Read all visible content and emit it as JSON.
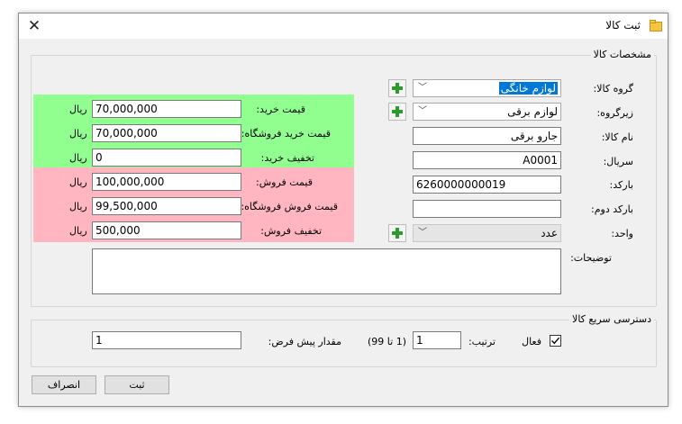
{
  "window": {
    "title": "ثبت کالا"
  },
  "product_details": {
    "legend": "مشخصات کالا",
    "group": {
      "label": "گروه کالا:",
      "value": "لوازم خانگی"
    },
    "subgroup": {
      "label": "زیرگروه:",
      "value": "لوازم برقی"
    },
    "name": {
      "label": "نام کالا:",
      "value": "جارو برقی"
    },
    "serial": {
      "label": "سریال:",
      "value": "A0001"
    },
    "barcode": {
      "label": "بارکد:",
      "value": "6260000000019"
    },
    "barcode2": {
      "label": "بارکد دوم:",
      "value": ""
    },
    "unit": {
      "label": "واحد:",
      "value": "عدد"
    },
    "description": {
      "label": "توضیحات:",
      "value": ""
    }
  },
  "pricing": {
    "currency": "ریال",
    "purchase_price": {
      "label": "قیمت خرید:",
      "value": "70,000,000"
    },
    "store_purchase_price": {
      "label": "قیمت خرید فروشگاه:",
      "value": "70,000,000"
    },
    "purchase_discount": {
      "label": "تخفیف خرید:",
      "value": "0"
    },
    "sale_price": {
      "label": "قیمت فروش:",
      "value": "100,000,000"
    },
    "store_sale_price": {
      "label": "قیمت فروش فروشگاه:",
      "value": "99,500,000"
    },
    "sale_discount": {
      "label": "تخفیف فروش:",
      "value": "500,000"
    }
  },
  "quick_access": {
    "legend": "دسترسی سریع کالا",
    "active": {
      "label": "فعال",
      "checked": true
    },
    "order": {
      "label": "ترتیب:",
      "value": "1",
      "range": "(1 تا 99)"
    },
    "default_qty": {
      "label": "مقدار پیش فرض:",
      "value": "1"
    }
  },
  "buttons": {
    "submit": "ثبت",
    "cancel": "انصراف"
  },
  "colors": {
    "purchase_panel": "#90ff90",
    "sale_panel": "#ffb6c1",
    "add_icon": "#2e9a2e",
    "selection": "#0078d7"
  }
}
